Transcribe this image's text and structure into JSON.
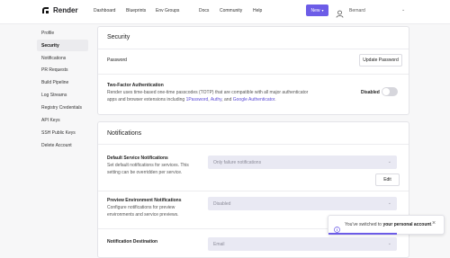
{
  "brand": {
    "name": "Render"
  },
  "nav": [
    "Dashboard",
    "Blueprints",
    "Env Groups",
    "Docs",
    "Community",
    "Help"
  ],
  "header": {
    "new_label": "New",
    "user_name": "Bernard"
  },
  "sidebar": {
    "items": [
      {
        "label": "Profile"
      },
      {
        "label": "Security"
      },
      {
        "label": "Notifications"
      },
      {
        "label": "PR Requests"
      },
      {
        "label": "Build Pipeline"
      },
      {
        "label": "Log Streams"
      },
      {
        "label": "Registry Credentials"
      },
      {
        "label": "API Keys"
      },
      {
        "label": "SSH Public Keys"
      },
      {
        "label": "Delete Account"
      }
    ],
    "active": "Security"
  },
  "security": {
    "title": "Security",
    "password_label": "Password",
    "update_password": "Update Password",
    "twofa_label": "Two-Factor Authentication",
    "twofa_desc_pre": "Render uses time-based one-time passcodes (TOTP) that are compatible with all major authenticator apps and browser extensions including ",
    "twofa_link1": "1Password",
    "twofa_sep1": ", ",
    "twofa_link2": "Authy",
    "twofa_sep2": ", and ",
    "twofa_link3": "Google Authenticator",
    "twofa_end": ".",
    "twofa_status": "Disabled"
  },
  "notifications": {
    "title": "Notifications",
    "default_label": "Default Service Notifications",
    "default_desc": "Set default notifications for services. This setting can be overridden per service.",
    "default_value": "Only failure notifications",
    "edit": "Edit",
    "preview_label": "Preview Environment Notifications",
    "preview_desc": "Configure notifications for preview environments and service previews.",
    "preview_value": "Disabled",
    "dest_label": "Notification Destination",
    "dest_value": "Email"
  },
  "toast": {
    "text_pre": "You've switched to ",
    "text_bold": "your personal account",
    "text_end": "."
  },
  "colors": {
    "accent": "#6c5ce7",
    "link": "#5b4bd6"
  }
}
